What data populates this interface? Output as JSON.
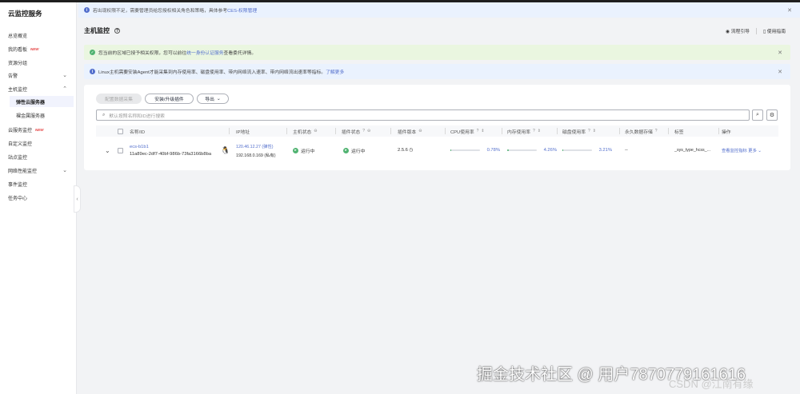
{
  "sidebar": {
    "title": "云监控服务",
    "items": [
      {
        "label": "总览概览"
      },
      {
        "label": "我的看板",
        "badge": "NEW"
      },
      {
        "label": "资源分组"
      },
      {
        "label": "告警"
      },
      {
        "label": "主机监控"
      },
      {
        "label": "弹性云服务器"
      },
      {
        "label": "裸金属服务器"
      },
      {
        "label": "云服务监控",
        "badge": "NEW"
      },
      {
        "label": "自定义监控"
      },
      {
        "label": "站点监控"
      },
      {
        "label": "网络性能监控"
      },
      {
        "label": "事件监控"
      },
      {
        "label": "任务中心"
      }
    ]
  },
  "top_banner": {
    "text": "若出现权限不足，需要管理员给您授权相关角色和策略，具体参考",
    "link": "CES-权限管理"
  },
  "header": {
    "title": "主机监控",
    "actions": [
      "流程引导",
      "使用指南"
    ]
  },
  "alert_green": {
    "text": "您当前的区域已授予相关权限，您可以前往",
    "link": "统一身份认证服务",
    "suffix": "查看委托详情。"
  },
  "alert_blue": {
    "text": "Linux主机需要安装Agent才能采集到内存使用率、磁盘使用率、带内网络流入速率、带内网络流出速率等指标。",
    "link": "了解更多"
  },
  "toolbar": {
    "batch_button": "配置数据采集",
    "install_button": "安装/升级插件",
    "export_button": "导出"
  },
  "search": {
    "placeholder": "默认按照名称和ID进行搜索"
  },
  "table": {
    "columns": [
      "名称/ID",
      "IP地址",
      "主机状态",
      "插件状态",
      "插件版本",
      "CPU使用率",
      "内存使用率",
      "磁盘使用率",
      "永久数据存储",
      "标签",
      "操作"
    ],
    "rows": [
      {
        "name": "ecs-b1b1",
        "id": "11a89ec-2df7-40bf-986b-73fa3166b8ba",
        "ip_public": "120.46.12.27 (弹性)",
        "ip_private": "192.168.0.169 (私有)",
        "host_status": "运行中",
        "plugin_status": "运行中",
        "plugin_version": "2.5.6",
        "cpu": "0.78%",
        "cpu_fraction": 0.0078,
        "memory": "4.26%",
        "memory_fraction": 0.0426,
        "disk": "3.21%",
        "disk_fraction": 0.0321,
        "storage": "--",
        "tag": "_sys_type_hcss_...",
        "action_view": "查看监控指标",
        "action_more": "更多"
      }
    ]
  },
  "watermark": {
    "text": "掘金技术社区 @ 用户7870779161616",
    "csdn": "CSDN @江南有缘"
  },
  "colors": {
    "accent": "#526ecc",
    "success": "#50b371",
    "danger": "#e54545"
  }
}
